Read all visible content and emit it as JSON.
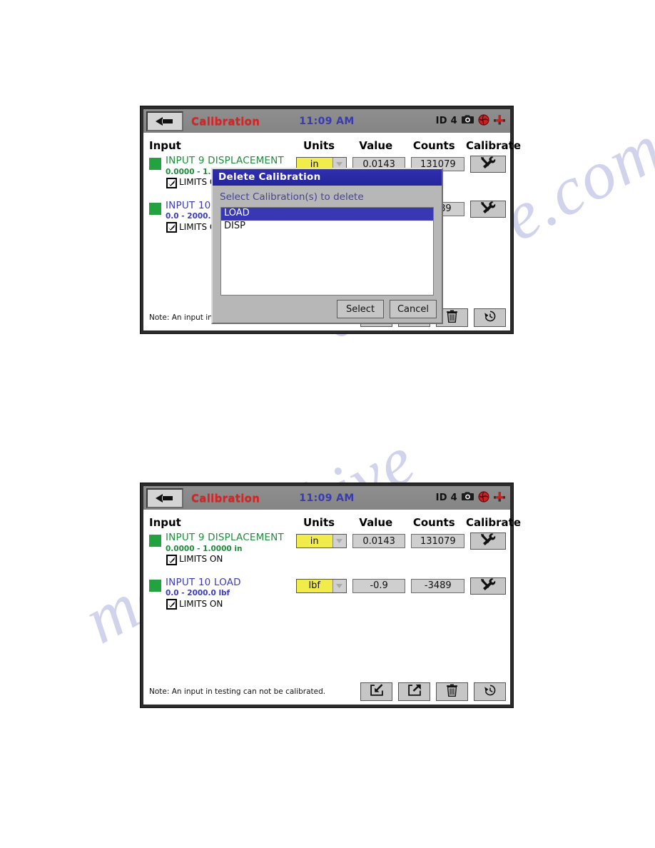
{
  "watermark": {
    "line1": "dalsnive.com",
    "line2": "manualshive"
  },
  "panels": [
    {
      "id": "panel-1",
      "titlebar": {
        "back_icon": "back-arrow-icon",
        "title": "Calibration",
        "clock": "11:09 AM",
        "id_label": "ID 4",
        "icons": [
          "camera-icon",
          "globe-icon",
          "machine-icon"
        ]
      },
      "table": {
        "headers": {
          "input": "Input",
          "units": "Units",
          "value": "Value",
          "counts": "Counts",
          "calibrate": "Calibrate"
        },
        "rows": [
          {
            "status_color": "#22a33f",
            "name": "INPUT 9 DISPLACEMENT",
            "range": "0.0000 - 1.0000 in",
            "limits_label": "LIMITS ON",
            "limits_checked": true,
            "name_color": "#1e8c3a",
            "units": "in",
            "value": "0.0143",
            "counts": "131079",
            "calibrate_icon": "wrench-screwdriver-icon"
          },
          {
            "status_color": "#22a33f",
            "name": "INPUT 10 LOAD",
            "range": "0.0 - 2000.0 lbf",
            "limits_label": "LIMITS ON",
            "limits_checked": true,
            "name_color": "#3b3bbb",
            "units": "lbf",
            "value": "-0.9",
            "counts": "-3489",
            "calibrate_icon": "wrench-screwdriver-icon"
          }
        ]
      },
      "footer": {
        "note": "Note:  An input in testing can not be calibrated.",
        "buttons": [
          {
            "name": "import-calibration-button",
            "icon": "import-arrow-icon"
          },
          {
            "name": "export-calibration-button",
            "icon": "export-arrow-icon"
          },
          {
            "name": "delete-calibration-button",
            "icon": "trash-icon"
          },
          {
            "name": "restore-calibration-button",
            "icon": "history-clock-icon"
          }
        ]
      },
      "dialog": {
        "visible": true,
        "title": "Delete Calibration",
        "prompt": "Select Calibration(s) to delete",
        "items": [
          {
            "label": "LOAD",
            "selected": true
          },
          {
            "label": "DISP",
            "selected": false
          }
        ],
        "select_label": "Select",
        "cancel_label": "Cancel"
      }
    },
    {
      "id": "panel-2",
      "titlebar": {
        "back_icon": "back-arrow-icon",
        "title": "Calibration",
        "clock": "11:09 AM",
        "id_label": "ID 4",
        "icons": [
          "camera-icon",
          "globe-icon",
          "machine-icon"
        ]
      },
      "table": {
        "headers": {
          "input": "Input",
          "units": "Units",
          "value": "Value",
          "counts": "Counts",
          "calibrate": "Calibrate"
        },
        "rows": [
          {
            "status_color": "#22a33f",
            "name": "INPUT 9 DISPLACEMENT",
            "range": "0.0000 - 1.0000 in",
            "limits_label": "LIMITS ON",
            "limits_checked": true,
            "name_color": "#1e8c3a",
            "units": "in",
            "value": "0.0143",
            "counts": "131079",
            "calibrate_icon": "wrench-screwdriver-icon"
          },
          {
            "status_color": "#22a33f",
            "name": "INPUT 10 LOAD",
            "range": "0.0 - 2000.0 lbf",
            "limits_label": "LIMITS ON",
            "limits_checked": true,
            "name_color": "#3b3bbb",
            "units": "lbf",
            "value": "-0.9",
            "counts": "-3489",
            "calibrate_icon": "wrench-screwdriver-icon"
          }
        ]
      },
      "footer": {
        "note": "Note:  An input in testing can not be calibrated.",
        "buttons": [
          {
            "name": "import-calibration-button",
            "icon": "import-arrow-icon"
          },
          {
            "name": "export-calibration-button",
            "icon": "export-arrow-icon"
          },
          {
            "name": "delete-calibration-button",
            "icon": "trash-icon"
          },
          {
            "name": "restore-calibration-button",
            "icon": "history-clock-icon"
          }
        ]
      },
      "dialog": {
        "visible": false
      }
    }
  ],
  "colors": {
    "accent_red": "#e02020",
    "clock_blue": "#3a3ab0",
    "status_green": "#22a33f",
    "units_yellow": "#f2ec4a",
    "dialog_blue": "#2a2aa8"
  }
}
